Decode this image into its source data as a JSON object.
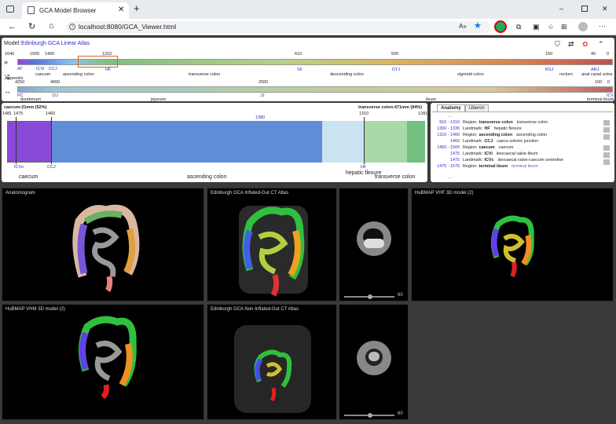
{
  "browser": {
    "tab_title": "GCA Model Browser",
    "url": "localhost:8080/GCA_Viewer.html",
    "icons": [
      "tab-actions-icon",
      "close-icon",
      "plus-icon",
      "minimize-icon",
      "maximize-icon",
      "close-window-icon",
      "back-icon",
      "refresh-icon",
      "home-icon",
      "info-icon",
      "read-aloud-icon",
      "favorite-star-icon",
      "extension-icon",
      "extensions-icon",
      "split-icon",
      "favorites-icon",
      "collections-icon",
      "profile-icon",
      "more-icon"
    ]
  },
  "model": {
    "label": "Model:",
    "name": "Edinburgh GCA Linear Atlas"
  },
  "track1": {
    "ticks": [
      "1640",
      "1500",
      "1460",
      "1310",
      "610",
      "500",
      "160",
      "40",
      "0"
    ],
    "landmarks": [
      "ICVo",
      "CCJ",
      "HF",
      "SF",
      "DTJ",
      "RSJ",
      "ARJ"
    ],
    "regions": [
      "caecum",
      "ascending colon",
      "transverse colon",
      "descending colon",
      "sigmoid colon",
      "rectum",
      "anal canal",
      "extra"
    ],
    "small": [
      "AT",
      "ICVi",
      "CCJ"
    ]
  },
  "track2": {
    "ticks": [
      "4250",
      "4000",
      "2500",
      "100",
      "0"
    ],
    "landmarks": [
      "DJ",
      "ICV"
    ],
    "small": [
      "PC"
    ],
    "regions": [
      "appendix",
      "duodenum",
      "jejunum",
      "ileum",
      "terminal ileum"
    ]
  },
  "detail": {
    "left_label": "caecum:21mm (52%)",
    "right_label": "transverse colon:471mm (94%)",
    "ticks": [
      "1481",
      "1475",
      "1460",
      "1380",
      "1310",
      "1281"
    ],
    "landmarks": [
      "ICVo",
      "CCJ",
      "HF"
    ],
    "regions": [
      "caecum",
      "ascending colon",
      "hepatic flexure",
      "transverse colon"
    ]
  },
  "info": {
    "tabs": [
      "Anatomy",
      "Uberon"
    ],
    "rows": [
      {
        "range": "810 - 1310",
        "kind": "Region:",
        "name": "transverse colon",
        "desc": "transverse colon"
      },
      {
        "range": "1300 - 1330",
        "kind": "Landmark:",
        "name": "HF",
        "desc": "hepatic flexure"
      },
      {
        "range": "1310 - 1460",
        "kind": "Region:",
        "name": "ascending colon",
        "desc": "ascending colon"
      },
      {
        "range": "1460",
        "kind": "Landmark:",
        "name": "CCJ",
        "desc": "caeco-colonic junction"
      },
      {
        "range": "1460 - 1500",
        "kind": "Region:",
        "name": "caecum",
        "desc": "caecum"
      },
      {
        "range": "1475",
        "kind": "Landmark:",
        "name": "ICVi",
        "desc": "ileocaecal valve-ileum"
      },
      {
        "range": "1475",
        "kind": "Landmark:",
        "name": "ICVc",
        "desc": "ileocaecal valve-caecum centreline"
      },
      {
        "range": "1475 - 1575",
        "kind": "Region:",
        "name": "terminal ileum",
        "desc": "terminal ileum"
      }
    ],
    "more": "..."
  },
  "viewports": {
    "anatomogram": "Anatomogram",
    "inflated": "Edinburgh GCA Inflated-Gut CT Atlas",
    "vhf": "HuBMAP VHF 3D model (2)",
    "vhm": "HuBMAP VHM 3D model (2)",
    "noninflated": "Edinburgh GCA Non-Inflated-Gut CT Atlas",
    "slider1": "60",
    "slider2": "60"
  }
}
